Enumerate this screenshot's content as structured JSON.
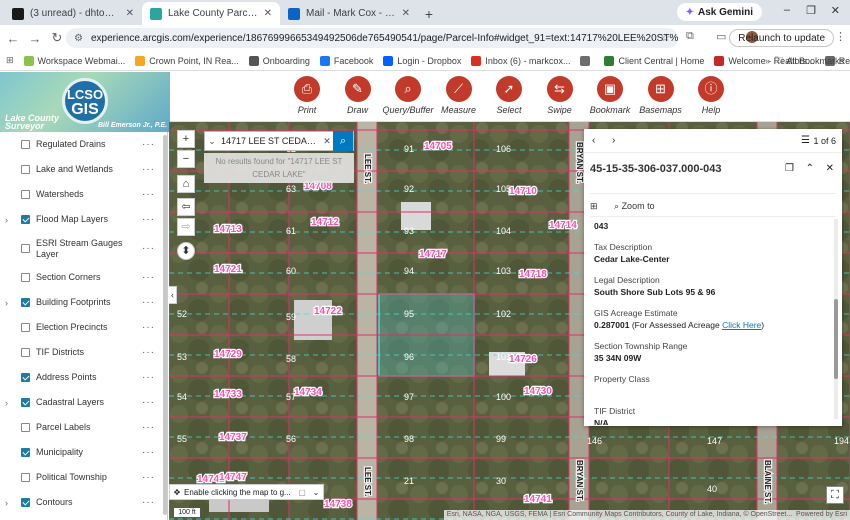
{
  "browser": {
    "tabs": [
      {
        "label": "(3 unread) - dhtool@aol.com - ...",
        "icon": "aol-icon",
        "color": "#1a1a1a",
        "active": false
      },
      {
        "label": "Lake County Parcel Viewer Site",
        "icon": "arcgis-icon",
        "color": "#2aa5a0",
        "active": true
      },
      {
        "label": "Mail - Mark Cox - Outlook",
        "icon": "outlook-icon",
        "color": "#0a64c2",
        "active": false
      }
    ],
    "gemini_label": "Ask Gemini",
    "url": "experience.arcgis.com/experience/186769996653494925​06de765490541/page/Parcel-Info#widget_91=text:14717%20LEE%20ST%20CEDAR%20LAKE",
    "relaunch_label": "Relaunch to update",
    "bookmarks": [
      {
        "label": "Workspace Webmai...",
        "color": "#8bc34a"
      },
      {
        "label": "Crown Point, IN Rea...",
        "color": "#f5a623"
      },
      {
        "label": "Onboarding",
        "color": "#555555"
      },
      {
        "label": "Facebook",
        "color": "#1877f2"
      },
      {
        "label": "Login - Dropbox",
        "color": "#0061fe"
      },
      {
        "label": "Inbox (6) - markcox...",
        "color": "#d93025"
      },
      {
        "label": "",
        "color": "#6d6d6d"
      },
      {
        "label": "Client Central | Home",
        "color": "#2e7d32"
      },
      {
        "label": "Welcome - Realtors...",
        "color": "#c62828"
      },
      {
        "label": "Resources",
        "color": "#666666"
      }
    ],
    "all_bookmarks_label": "All Bookmarks"
  },
  "app": {
    "logo_line1": "LCSO",
    "logo_line2": "GIS",
    "logo_caption": "Lake County Surveyor",
    "logo_author": "Bill Emerson Jr., P.E.",
    "toolbar": [
      {
        "label": "Print",
        "icon": "print-icon",
        "glyph": "⎙"
      },
      {
        "label": "Draw",
        "icon": "draw-icon",
        "glyph": "✎"
      },
      {
        "label": "Query/Buffer",
        "icon": "query-icon",
        "glyph": "⌕"
      },
      {
        "label": "Measure",
        "icon": "measure-icon",
        "glyph": "⟋"
      },
      {
        "label": "Select",
        "icon": "select-icon",
        "glyph": "➚"
      },
      {
        "label": "Swipe",
        "icon": "swipe-icon",
        "glyph": "⇆"
      },
      {
        "label": "Bookmark",
        "icon": "bookmark-icon",
        "glyph": "▣"
      },
      {
        "label": "Basemaps",
        "icon": "basemaps-icon",
        "glyph": "⊞"
      },
      {
        "label": "Help",
        "icon": "help-icon",
        "glyph": "ⓘ"
      }
    ],
    "accent": "#c23a2a"
  },
  "layers": [
    {
      "name": "Regulated Drains",
      "checked": false,
      "expandable": false
    },
    {
      "name": "Lake and Wetlands",
      "checked": false,
      "expandable": false
    },
    {
      "name": "Watersheds",
      "checked": false,
      "expandable": false
    },
    {
      "name": "Flood Map Layers",
      "checked": true,
      "expandable": true
    },
    {
      "name": "ESRI Stream Gauges Layer",
      "checked": false,
      "expandable": false
    },
    {
      "name": "Section Corners",
      "checked": false,
      "expandable": false
    },
    {
      "name": "Building Footprints",
      "checked": true,
      "expandable": true
    },
    {
      "name": "Election Precincts",
      "checked": false,
      "expandable": false
    },
    {
      "name": "TIF Districts",
      "checked": false,
      "expandable": false
    },
    {
      "name": "Address Points",
      "checked": true,
      "expandable": false
    },
    {
      "name": "Cadastral Layers",
      "checked": true,
      "expandable": true
    },
    {
      "name": "Parcel Labels",
      "checked": false,
      "expandable": false
    },
    {
      "name": "Municipality",
      "checked": true,
      "expandable": false
    },
    {
      "name": "Political Township",
      "checked": false,
      "expandable": false
    },
    {
      "name": "Contours",
      "checked": true,
      "expandable": true
    }
  ],
  "map": {
    "search_value": "14717 LEE ST CEDAR L...",
    "no_results": "No results found for \"14717 LEE ST CEDAR LAKE\"",
    "enable_click": "Enable clicking the map to g...",
    "scale_label": "100 ft",
    "attribution": "Esri, NASA, NGA, USGS, FEMA | Esri Community Maps Contributors, County of Lake, Indiana, © OpenStreet...",
    "powered_by": "Powered by Esri",
    "street_labels": [
      "LEE ST.",
      "LEE ST.",
      "BRYAN ST.",
      "BRYAN ST.",
      "BLAINE ST."
    ],
    "address_labels": [
      "14705",
      "14708",
      "14710",
      "14712",
      "14713",
      "14714",
      "14717",
      "14718",
      "14721",
      "14722",
      "14726",
      "14729",
      "14730",
      "14733",
      "14734",
      "14737",
      "14738",
      "14741",
      "14742",
      "14747"
    ],
    "lot_labels": [
      "91",
      "92",
      "93",
      "94",
      "95",
      "96",
      "97",
      "98",
      "62",
      "61",
      "60",
      "59",
      "58",
      "57",
      "56",
      "106",
      "105",
      "104",
      "103",
      "102",
      "101",
      "100",
      "99",
      "21",
      "30",
      "146",
      "147",
      "40",
      "52",
      "53",
      "54",
      "55",
      "194",
      "63"
    ]
  },
  "popup": {
    "pager": "1 of 6",
    "title": "45-15-35-306-037.000-043",
    "zoom_label": "Zoom to",
    "first_value": "043",
    "fields": [
      {
        "label": "Tax Description",
        "value": "Cedar Lake-Center"
      },
      {
        "label": "Legal Description",
        "value": "South Shore Sub Lots 95 & 96"
      },
      {
        "label": "GIS Acreage Estimate",
        "value": "0.287001",
        "suffix": " (For Assessed Acreage ",
        "link": "Click Here",
        "close": ")"
      },
      {
        "label": "Section Township Range",
        "value": "35 34N 09W"
      },
      {
        "label": "Property Class",
        "value": ""
      },
      {
        "label": "TIF District",
        "value": "N/A"
      }
    ]
  }
}
